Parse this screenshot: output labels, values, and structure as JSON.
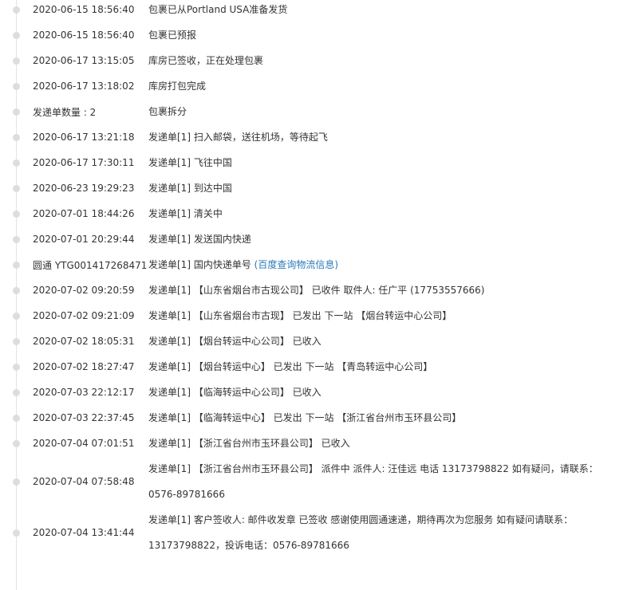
{
  "timeline": {
    "rows": [
      {
        "time": "2020-06-15 18:56:40",
        "event": "包裹已从Portland USA准备发货"
      },
      {
        "time": "2020-06-15 18:56:40",
        "event": "包裹已预报"
      },
      {
        "time": "2020-06-17 13:15:05",
        "event": "库房已签收，正在处理包裹"
      },
      {
        "time": "2020-06-17 13:18:02",
        "event": "库房打包完成"
      },
      {
        "time": "发递单数量 : 2",
        "event": "包裹拆分"
      },
      {
        "time": "2020-06-17 13:21:18",
        "event": "发递单[1] 扫入邮袋，送往机场，等待起飞"
      },
      {
        "time": "2020-06-17 17:30:11",
        "event": "发递单[1] 飞往中国"
      },
      {
        "time": "2020-06-23 19:29:23",
        "event": "发递单[1] 到达中国"
      },
      {
        "time": "2020-07-01 18:44:26",
        "event": "发递单[1] 清关中"
      },
      {
        "time": "2020-07-01 20:29:44",
        "event": "发递单[1] 发送国内快递"
      },
      {
        "time": "圆通 YTG001417268471",
        "event": "发递单[1] 国内快递单号 ",
        "link": "(百度查询物流信息)"
      },
      {
        "time": "2020-07-02 09:20:59",
        "event": "发递单[1] 【山东省烟台市古现公司】 已收件 取件人: 任广平 (17753557666)"
      },
      {
        "time": "2020-07-02 09:21:09",
        "event": "发递单[1] 【山东省烟台市古现】 已发出 下一站 【烟台转运中心公司】"
      },
      {
        "time": "2020-07-02 18:05:31",
        "event": "发递单[1] 【烟台转运中心公司】 已收入"
      },
      {
        "time": "2020-07-02 18:27:47",
        "event": "发递单[1] 【烟台转运中心】 已发出 下一站 【青岛转运中心公司】"
      },
      {
        "time": "2020-07-03 22:12:17",
        "event": "发递单[1] 【临海转运中心公司】 已收入"
      },
      {
        "time": "2020-07-03 22:37:45",
        "event": "发递单[1] 【临海转运中心】 已发出 下一站 【浙江省台州市玉环县公司】"
      },
      {
        "time": "2020-07-04 07:01:51",
        "event": "发递单[1] 【浙江省台州市玉环县公司】 已收入"
      },
      {
        "time": "2020-07-04 07:58:48",
        "event": "发递单[1] 【浙江省台州市玉环县公司】 派件中 派件人: 汪佳远 电话 13173798822 如有疑问，请联系：0576-89781666"
      },
      {
        "time": "2020-07-04 13:41:44",
        "event": "发递单[1] 客户签收人: 邮件收发章 已签收 感谢使用圆通速递，期待再次为您服务 如有疑问请联系：13173798822，投诉电话：0576-89781666"
      }
    ]
  }
}
